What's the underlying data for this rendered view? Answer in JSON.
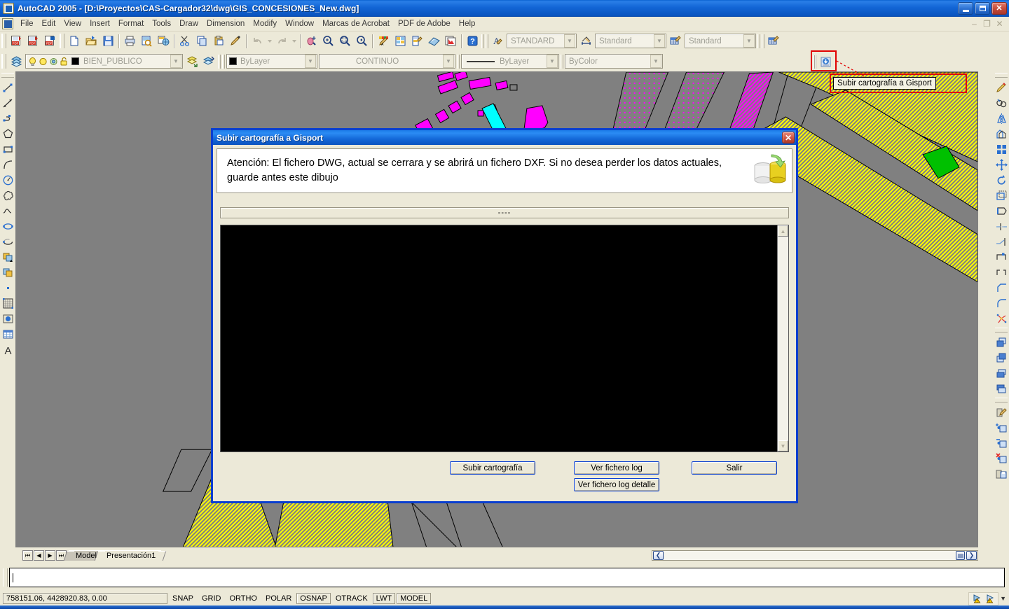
{
  "window": {
    "app_icon": "autocad-icon",
    "title": "AutoCAD 2005 - [D:\\Proyectos\\CAS-Cargador32\\dwg\\GIS_CONCESIONES_New.dwg]",
    "minimize": "–",
    "maximize": "❐",
    "close": "✕"
  },
  "menu": {
    "items": [
      {
        "label": "File"
      },
      {
        "label": "Edit"
      },
      {
        "label": "View"
      },
      {
        "label": "Insert"
      },
      {
        "label": "Format"
      },
      {
        "label": "Tools"
      },
      {
        "label": "Draw"
      },
      {
        "label": "Dimension"
      },
      {
        "label": "Modify"
      },
      {
        "label": "Window"
      },
      {
        "label": "Marcas de Acrobat"
      },
      {
        "label": "PDF de Adobe"
      },
      {
        "label": "Help"
      }
    ],
    "doc_minimize": "–",
    "doc_restore": "❐",
    "doc_close": "✕"
  },
  "toolbars": {
    "acrobat": [
      "pdf-convert-icon",
      "pdf-export-icon",
      "pdf-settings-icon"
    ],
    "standard": [
      "new-icon",
      "open-icon",
      "save-icon",
      "plot-icon",
      "plot-preview-icon",
      "publish-icon",
      "cut-icon",
      "copy-icon",
      "paste-icon",
      "match-properties-icon",
      "undo-icon",
      "redo-icon",
      "pan-realtime-icon",
      "zoom-realtime-icon",
      "zoom-window-icon",
      "zoom-previous-icon",
      "properties-icon",
      "designcenter-icon",
      "tool-palettes-icon",
      "markup-set-icon",
      "sheet-set-icon",
      "help-icon"
    ],
    "styles": {
      "text_style_icon": "text-style-icon",
      "text_style_value": "STANDARD",
      "dim_style_icon": "dimension-style-icon",
      "dim_style_value": "Standard",
      "table_style_icon": "table-style-icon",
      "table_style_value": "Standard",
      "table_style_extra_icon": "table-style-icon"
    },
    "layers": {
      "layer_manager_icon": "layer-properties-manager-icon",
      "on_icon": "lightbulb-on-icon",
      "freeze_icon": "sun-freeze-icon",
      "freeze_vp_icon": "viewport-freeze-icon",
      "lock_icon": "padlock-unlocked-icon",
      "color_swatch": "#000000",
      "layer_name": "BIEN_PUBLICO",
      "previous_layer_icon": "layer-previous-icon",
      "make_current_icon": "make-object-layer-current-icon"
    },
    "properties": {
      "color_value": "ByLayer",
      "color_swatch": "#000000",
      "linetype_value": "CONTINUO",
      "lineweight_value": "ByLayer",
      "plotstyle_value": "ByColor"
    },
    "gisport": {
      "icon": "subir-cartografia-icon",
      "tooltip": "Subir cartografía a Gisport",
      "highlight_color": "#e00000"
    }
  },
  "draw_toolbar": [
    "line-icon",
    "construction-line-icon",
    "polyline-icon",
    "polygon-icon",
    "rectangle-icon",
    "arc-icon",
    "circle-icon",
    "revision-cloud-icon",
    "spline-icon",
    "ellipse-icon",
    "ellipse-arc-icon",
    "insert-block-icon",
    "make-block-icon",
    "point-icon",
    "hatch-icon",
    "region-icon",
    "table-icon",
    "multiline-text-icon"
  ],
  "modify_toolbar": [
    "erase-icon",
    "copy-object-icon",
    "mirror-icon",
    "offset-icon",
    "array-icon",
    "move-icon",
    "rotate-icon",
    "scale-icon",
    "stretch-icon",
    "trim-icon",
    "extend-icon",
    "break-at-point-icon",
    "break-icon",
    "chamfer-icon",
    "fillet-icon",
    "explode-icon",
    "draworder-front-icon",
    "draworder-back-icon",
    "draworder-above-icon",
    "draworder-below-icon",
    "edit-attribute-icon",
    "insert-block-plus-icon",
    "delete-block-minus-icon",
    "remove-block-x-icon",
    "save-block-icon"
  ],
  "canvas": {
    "background_color": "#808080",
    "layer_colors": {
      "parcel_yellow": "#ffff00",
      "building_magenta": "#ff00ff",
      "highlight_cyan": "#00ffff",
      "marker_green": "#00c000",
      "outline_black": "#000000"
    }
  },
  "layout_tabs": {
    "nav": [
      "first-tab-icon",
      "prev-tab-icon",
      "next-tab-icon",
      "last-tab-icon"
    ],
    "tabs": [
      {
        "label": "Model",
        "active": true
      },
      {
        "label": "Presentación1",
        "active": false
      }
    ]
  },
  "hscrollbar": {
    "left_icon": "scroll-left-icon",
    "grip_icon": "scroll-grip-icon",
    "right_icon": "scroll-right-icon"
  },
  "command_line": {
    "value": "",
    "placeholder": ""
  },
  "status_bar": {
    "coordinates": "758151.06, 4428920.83, 0.00",
    "toggles": [
      {
        "label": "SNAP",
        "on": false
      },
      {
        "label": "GRID",
        "on": false
      },
      {
        "label": "ORTHO",
        "on": false
      },
      {
        "label": "POLAR",
        "on": false
      },
      {
        "label": "OSNAP",
        "on": true
      },
      {
        "label": "OTRACK",
        "on": false
      },
      {
        "label": "LWT",
        "on": true
      },
      {
        "label": "MODEL",
        "on": true
      }
    ],
    "tray": [
      "communication-center-warning-icon",
      "manage-xrefs-warning-icon"
    ],
    "tray_arrow": "▼"
  },
  "dialog": {
    "title": "Subir cartografía a Gisport",
    "close_label": "✕",
    "warning_text": "Atención: El fichero DWG, actual se cerrara y se abrirá un fichero DXF. Si no desea perder los datos actuales, guarde antes este dibujo",
    "warning_icon": "upload-database-icon",
    "progress_label": "----",
    "log_content": "",
    "log_scroll_up": "▲",
    "log_scroll_down": "▼",
    "buttons": {
      "subir": "Subir cartografía",
      "ver_log": "Ver fichero log",
      "salir": "Salir",
      "ver_log_detalle": "Ver fichero log detalle"
    }
  }
}
